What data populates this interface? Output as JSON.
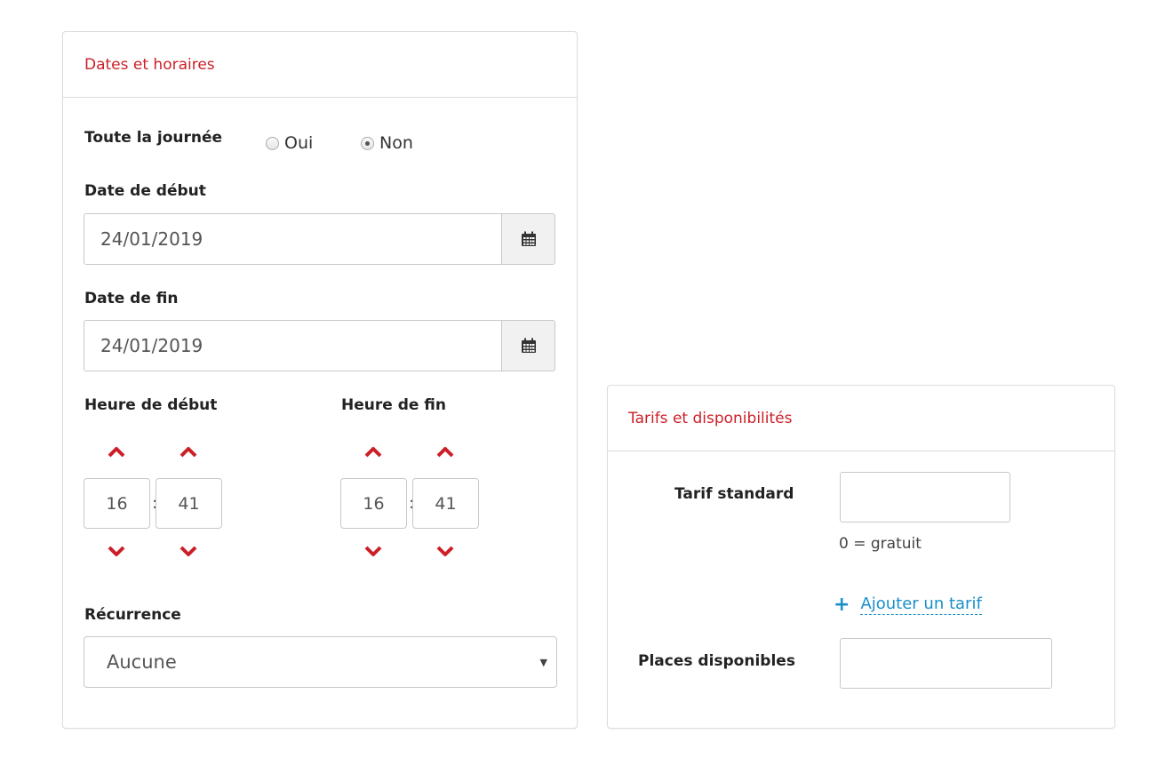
{
  "dates_panel": {
    "title": "Dates et horaires",
    "all_day": {
      "label": "Toute la journée",
      "options": [
        "Oui",
        "Non"
      ],
      "selected": "Non"
    },
    "start_date": {
      "label": "Date de début",
      "value": "24/01/2019",
      "icon": "calendar-icon"
    },
    "end_date": {
      "label": "Date de fin",
      "value": "24/01/2019",
      "icon": "calendar-icon"
    },
    "start_time": {
      "label": "Heure de début",
      "hour": "16",
      "minute": "41",
      "separator": ":"
    },
    "end_time": {
      "label": "Heure de fin",
      "hour": "16",
      "minute": "41",
      "separator": ":"
    },
    "recurrence": {
      "label": "Récurrence",
      "selected": "Aucune"
    }
  },
  "tarifs_panel": {
    "title": "Tarifs et disponibilités",
    "standard_price": {
      "label": "Tarif standard",
      "value": "",
      "currency": "€",
      "hint": "0 = gratuit"
    },
    "add_price": {
      "icon": "plus-icon",
      "label": "Ajouter un tarif"
    },
    "available_seats": {
      "label": "Places disponibles",
      "value": "",
      "icon": "ticket-icon"
    }
  },
  "colors": {
    "accent_red": "#cc1f27",
    "link_blue": "#1a8fc8"
  }
}
